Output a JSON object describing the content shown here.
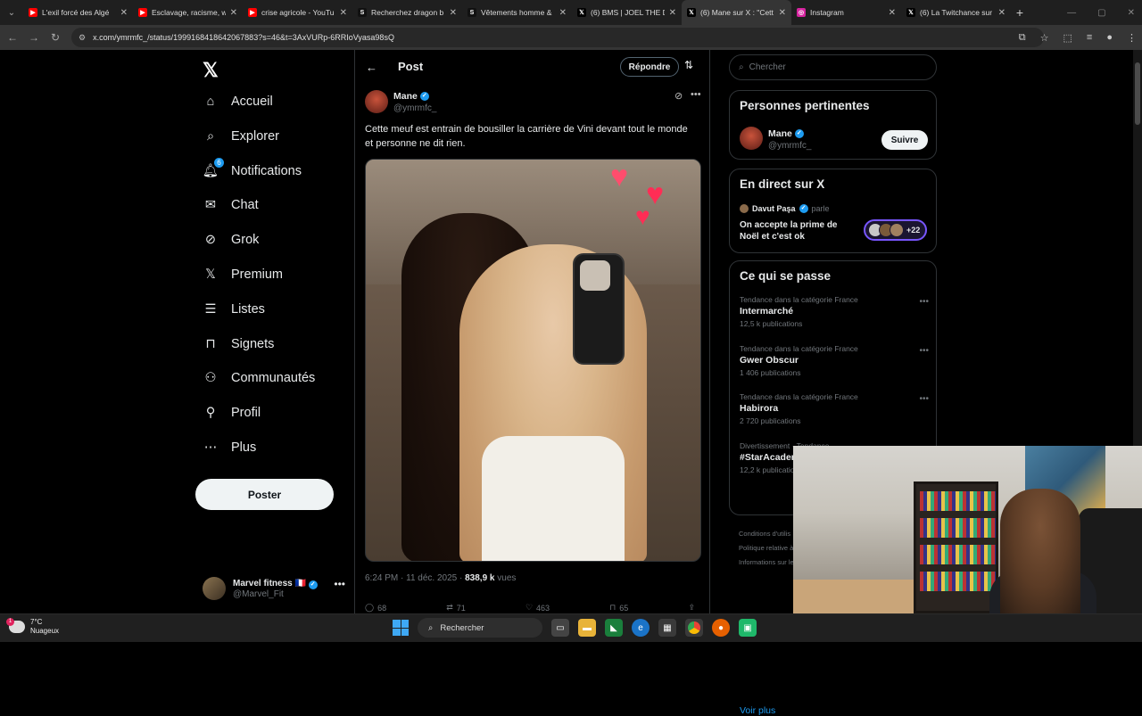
{
  "browser": {
    "tabs": [
      {
        "title": "L'exil forcé des Algé",
        "favicon": "youtube-icon",
        "color": "#ff0000",
        "active": false
      },
      {
        "title": "Esclavage, racisme, w",
        "favicon": "youtube-icon",
        "color": "#ff0000",
        "active": false
      },
      {
        "title": "crise agricole - YouTu",
        "favicon": "youtube-icon",
        "color": "#ff0000",
        "active": false
      },
      {
        "title": "Recherchez dragon b",
        "favicon": "s-icon",
        "color": "#111111",
        "active": false
      },
      {
        "title": "Vêtements homme &",
        "favicon": "s-icon",
        "color": "#111111",
        "active": false
      },
      {
        "title": "(6) BMS | JOEL THE D",
        "favicon": "x-icon",
        "color": "#000000",
        "active": false
      },
      {
        "title": "(6) Mane sur X : \"Cett",
        "favicon": "x-icon",
        "color": "#000000",
        "active": true
      },
      {
        "title": "Instagram",
        "favicon": "instagram-icon",
        "color": "#d6249f",
        "active": false
      },
      {
        "title": "(6) La Twitchance sur",
        "favicon": "x-icon",
        "color": "#000000",
        "active": false
      }
    ],
    "url": "x.com/ymrmfc_/status/1999168418642067883?s=46&t=3AxVURp-6RRIoVyasa98sQ"
  },
  "nav": {
    "items": [
      {
        "label": "Accueil",
        "icon": "home-icon"
      },
      {
        "label": "Explorer",
        "icon": "search-icon"
      },
      {
        "label": "Notifications",
        "icon": "bell-icon",
        "badge": "6"
      },
      {
        "label": "Chat",
        "icon": "mail-icon"
      },
      {
        "label": "Grok",
        "icon": "grok-icon"
      },
      {
        "label": "Premium",
        "icon": "x-logo-icon"
      },
      {
        "label": "Listes",
        "icon": "list-icon"
      },
      {
        "label": "Signets",
        "icon": "bookmark-icon"
      },
      {
        "label": "Communautés",
        "icon": "communities-icon"
      },
      {
        "label": "Profil",
        "icon": "profile-icon"
      },
      {
        "label": "Plus",
        "icon": "more-circle-icon"
      }
    ],
    "post_button": "Poster",
    "account": {
      "name": "Marvel fitness 🇫🇷",
      "handle": "@Marvel_Fit"
    }
  },
  "post": {
    "header_title": "Post",
    "reply_button": "Répondre",
    "author": {
      "name": "Mane",
      "handle": "@ymrmfc_"
    },
    "text": "Cette meuf est entrain de bousiller la carrière de Vini devant tout le monde et personne ne dit rien.",
    "time": "6:24 PM · 11 déc. 2025 · ",
    "views_count": "838,9 k",
    "views_label": " vues",
    "actions": {
      "replies": "68",
      "reposts": "71",
      "likes": "463",
      "bookmarks": "65"
    }
  },
  "sidebar": {
    "search_placeholder": "Chercher",
    "relevant": {
      "title": "Personnes pertinentes",
      "name": "Mane",
      "handle": "@ymrmfc_",
      "follow_label": "Suivre"
    },
    "live": {
      "title": "En direct sur X",
      "host": "Davut Paşa",
      "speaking": "parle",
      "space_title": "On accepte la prime de Noël et c'est ok",
      "listeners": "+22"
    },
    "trends": {
      "title": "Ce qui se passe",
      "items": [
        {
          "category": "Tendance dans la catégorie France",
          "name": "Intermarché",
          "count": "12,5 k publications"
        },
        {
          "category": "Tendance dans la catégorie France",
          "name": "Gwer Obscur",
          "count": "1 406 publications"
        },
        {
          "category": "Tendance dans la catégorie France",
          "name": "Habirora",
          "count": "2 720 publications"
        },
        {
          "category": "Divertissement · Tendance",
          "name": "#StarAcademy",
          "count": "12,2 k publications"
        }
      ],
      "see_more": "Voir plus"
    },
    "footer": [
      "Conditions d'utilis",
      "Politique relative à",
      "Informations sur le"
    ]
  },
  "taskbar": {
    "weather_temp": "7°C",
    "weather_desc": "Nuageux",
    "weather_badge": "1",
    "search_label": "Rechercher"
  }
}
